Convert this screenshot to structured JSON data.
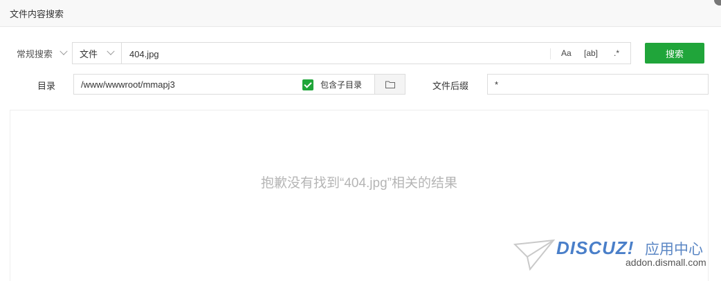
{
  "dialog": {
    "title": "文件内容搜索"
  },
  "search": {
    "mode": "常规搜索",
    "type": "文件",
    "keyword": "404.jpg",
    "options": {
      "case": "Aa",
      "word": "[ab]",
      "regex": ".*"
    },
    "button": "搜索"
  },
  "directory": {
    "label": "目录",
    "path": "/www/wwwroot/mmapj3",
    "include_sub_label": "包含子目录",
    "include_sub_checked": true
  },
  "suffix": {
    "label": "文件后缀",
    "value": "*"
  },
  "results": {
    "empty_message": "抱歉没有找到“404.jpg”相关的结果"
  },
  "watermark": {
    "brand": "DISCUZ!",
    "sub": "应用中心",
    "url": "addon.dismall.com"
  },
  "colors": {
    "accent": "#20a53a",
    "watermark": "#4a7fc9"
  }
}
